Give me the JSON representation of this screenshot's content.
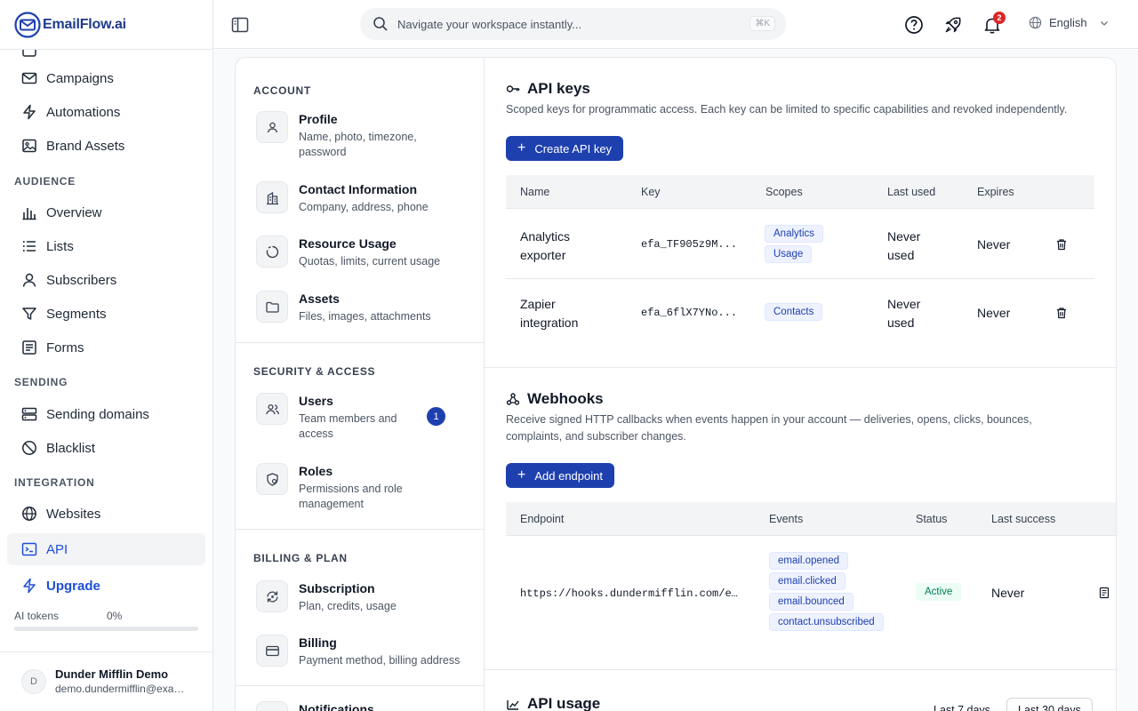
{
  "brand": {
    "name": "EmailFlow.ai"
  },
  "topbar": {
    "search_placeholder": "Navigate your workspace instantly...",
    "search_shortcut": "⌘K",
    "notifications_count": "2",
    "language": "English"
  },
  "sidebar": {
    "items": [
      {
        "label": "Campaigns",
        "icon": "mail-icon"
      },
      {
        "label": "Automations",
        "icon": "bolt-icon"
      },
      {
        "label": "Brand Assets",
        "icon": "image-icon"
      }
    ],
    "audience_title": "AUDIENCE",
    "audience": [
      {
        "label": "Overview",
        "icon": "bar-chart-icon"
      },
      {
        "label": "Lists",
        "icon": "list-icon"
      },
      {
        "label": "Subscribers",
        "icon": "user-icon"
      },
      {
        "label": "Segments",
        "icon": "filter-icon"
      },
      {
        "label": "Forms",
        "icon": "form-icon"
      }
    ],
    "sending_title": "SENDING",
    "sending": [
      {
        "label": "Sending domains",
        "icon": "server-icon"
      },
      {
        "label": "Blacklist",
        "icon": "ban-icon"
      }
    ],
    "integration_title": "INTEGRATION",
    "integration": [
      {
        "label": "Websites",
        "icon": "globe-icon"
      },
      {
        "label": "API",
        "icon": "terminal-icon",
        "active": true
      }
    ],
    "upgrade_label": "Upgrade",
    "ai_tokens_label": "AI tokens",
    "ai_tokens_pct": "0%",
    "ai_tokens_fraction": 0,
    "user": {
      "initial": "D",
      "name": "Dunder Mifflin Demo",
      "email": "demo.dundermifflin@example.com"
    }
  },
  "settings_nav": {
    "account_title": "ACCOUNT",
    "account": [
      {
        "title": "Profile",
        "desc": "Name, photo, timezone, password",
        "icon": "user-icon"
      },
      {
        "title": "Contact Information",
        "desc": "Company, address, phone",
        "icon": "building-icon"
      },
      {
        "title": "Resource Usage",
        "desc": "Quotas, limits, current usage",
        "icon": "gauge-icon"
      },
      {
        "title": "Assets",
        "desc": "Files, images, attachments",
        "icon": "folder-icon"
      }
    ],
    "security_title": "SECURITY & ACCESS",
    "security": [
      {
        "title": "Users",
        "desc": "Team members and access",
        "badge": "1",
        "icon": "users-icon"
      },
      {
        "title": "Roles",
        "desc": "Permissions and role management",
        "icon": "shield-icon"
      }
    ],
    "billing_title": "BILLING & PLAN",
    "billing": [
      {
        "title": "Subscription",
        "desc": "Plan, credits, usage",
        "icon": "refresh-icon"
      },
      {
        "title": "Billing",
        "desc": "Payment method, billing address",
        "icon": "card-icon"
      },
      {
        "title": "Notifications",
        "desc": "",
        "icon": "bell-icon"
      }
    ]
  },
  "api_keys": {
    "title": "API keys",
    "desc": "Scoped keys for programmatic access. Each key can be limited to specific capabilities and revoked independently.",
    "create_label": "Create API key",
    "columns": [
      "Name",
      "Key",
      "Scopes",
      "Last used",
      "Expires"
    ],
    "rows": [
      {
        "name": "Analytics exporter",
        "key": "efa_TF905z9M...",
        "scopes": [
          "Analytics",
          "Usage"
        ],
        "last_used": "Never used",
        "expires": "Never"
      },
      {
        "name": "Zapier integration",
        "key": "efa_6flX7YNo...",
        "scopes": [
          "Contacts"
        ],
        "last_used": "Never used",
        "expires": "Never"
      }
    ]
  },
  "webhooks": {
    "title": "Webhooks",
    "desc": "Receive signed HTTP callbacks when events happen in your account — deliveries, opens, clicks, bounces, complaints, and subscriber changes.",
    "add_label": "Add endpoint",
    "columns": [
      "Endpoint",
      "Events",
      "Status",
      "Last success"
    ],
    "rows": [
      {
        "endpoint": "https://hooks.dundermifflin.com/e…",
        "events": [
          "email.opened",
          "email.clicked",
          "email.bounced",
          "contact.unsubscribed"
        ],
        "status": "Active",
        "last_success": "Never"
      }
    ]
  },
  "api_usage": {
    "title": "API usage",
    "ranges": [
      "Last 7 days",
      "Last 30 days"
    ],
    "selected_range": "Last 30 days"
  }
}
